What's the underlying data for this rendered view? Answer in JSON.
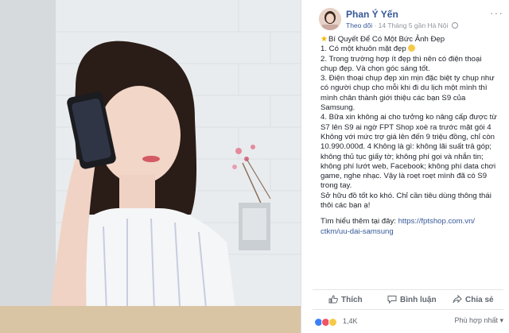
{
  "post": {
    "author": "Phan Ý Yến",
    "follow": "Theo dõi",
    "date": "14 Tháng 5 gần Hà Nội",
    "more": "···",
    "body_lines": [
      "Bí Quyết Để Có Một Bức Ảnh Đẹp",
      "1. Có một khuôn mặt đẹp",
      "2. Trong trường hợp ít đẹp thì nên có điện thoại",
      "chụp đẹp. Và chọn góc sáng tốt.",
      "3. Điện thoại chụp đẹp xin mịn đặc biệt ty chụp như",
      "có người chụp cho mỗi khi đi du lịch một mình thì",
      "mình chân thành giới thiệu các bạn S9 của",
      "Samsung.",
      "4. Bữa xin không ai cho tưởng ko nâng cấp được từ",
      "S7 lên S9 ai ngờ FPT Shop xoè ra trước mặt gói 4",
      "Không với mức trợ giá lên đến 9 triệu đồng, chỉ còn",
      "10.990.000đ. 4 Không là gì: không lãi suất trả góp;",
      "không thủ tục giấy tờ; không phí gọi và nhắn tin;",
      "không phí lướt web, Facebook; không phí data chơi",
      "game, nghe nhạc. Vậy là roẹt roẹt mình đã có S9",
      "trong tay.",
      "Sở hữu đồ tốt ko khó. Chỉ cần tiêu dùng thông thái",
      "thôi các bạn ạ!"
    ],
    "link_prefix": "Tìm hiểu thêm tại đây: ",
    "link_part1": "https://fptshop.com.vn/",
    "link_part2": "ctkm/uu-dai-samsung"
  },
  "actions": {
    "like": "Thích",
    "comment": "Bình luận",
    "share": "Chia sẻ"
  },
  "reactions": {
    "count": "1,4K",
    "sort": "Phù hợp nhất ▾"
  },
  "colors": {
    "link": "#365899",
    "meta": "#90949c",
    "text": "#1d2129"
  },
  "icons": [
    "star-icon",
    "smile-icon",
    "globe-icon",
    "like-icon",
    "comment-icon",
    "share-icon",
    "more-icon"
  ]
}
